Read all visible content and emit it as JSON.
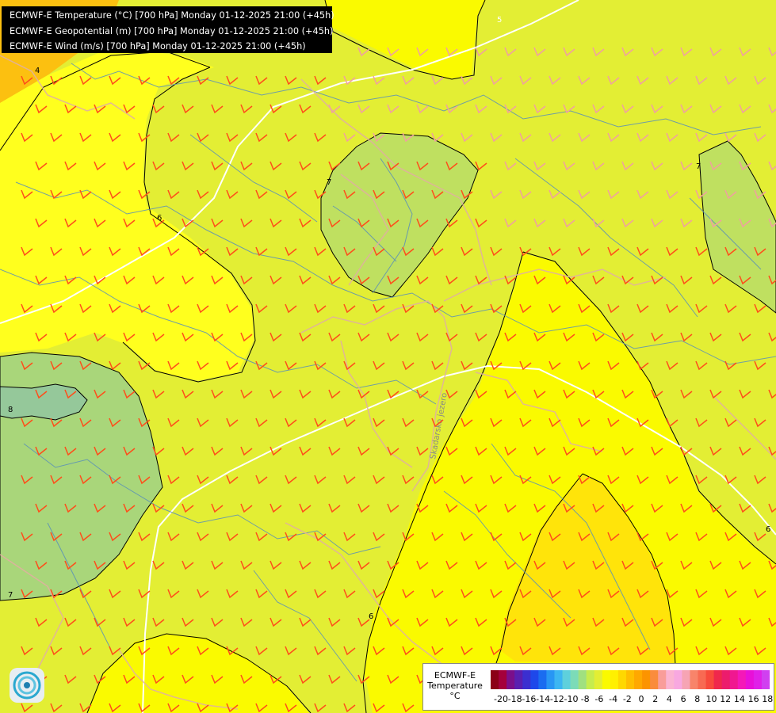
{
  "header": {
    "line1": "ECMWF-E Temperature (°C) [700 hPa] Monday 01-12-2025 21:00 (+45h)",
    "line2": "ECMWF-E Geopotential (m) [700 hPa] Monday 01-12-2025 21:00 (+45h)",
    "line3": "ECMWF-E Wind (m/s) [700 hPa] Monday 01-12-2025 21:00 (+45h)"
  },
  "map": {
    "contour_labels": [
      "4",
      "5",
      "6",
      "7",
      "8",
      "6",
      "7",
      "6",
      "7"
    ],
    "place_label": "Skadarsko jezero",
    "colors": {
      "background_field": "#e3ee34",
      "yellow_field": "#ffff1e",
      "bright_yellow_field": "#fafa00",
      "dark_yellow_field": "#ffe40a",
      "orange_field": "#fcc010",
      "green_field": "#bfe060",
      "teal_field": "#9fcf94",
      "barb_color": "#ff4d1a",
      "border_color": "#e0b0a0",
      "river_color": "#5a90b8",
      "geopotential_line": "#ffffff",
      "isotherm_line": "#000000"
    }
  },
  "legend": {
    "title_line1": "ECMWF-E",
    "title_line2": "Temperature",
    "title_line3": "°C",
    "ticks": [
      "-20",
      "-18",
      "-16",
      "-14",
      "-12",
      "-10",
      "-8",
      "-6",
      "-4",
      "-2",
      "0",
      "2",
      "4",
      "6",
      "8",
      "10",
      "12",
      "14",
      "16",
      "18"
    ],
    "colors": [
      "#8b0016",
      "#a4003b",
      "#7a0f8a",
      "#5a1fb0",
      "#3b2fd0",
      "#1e48ea",
      "#1a6cf0",
      "#2896f4",
      "#3cb6f2",
      "#5ed0dc",
      "#7cdbb8",
      "#a0e080",
      "#c6ec4e",
      "#e3ee34",
      "#fafa00",
      "#fff000",
      "#ffd800",
      "#ffbe00",
      "#ffa800",
      "#fc9400",
      "#fa8c3c",
      "#f99d9a",
      "#fbb4d2",
      "#f8a8e0",
      "#f6a4b4",
      "#f8846a",
      "#f86a52",
      "#f84a3c",
      "#f0284c",
      "#ec1c6c",
      "#f01890",
      "#f418b8",
      "#e810d8",
      "#e020e8",
      "#d040f0"
    ]
  }
}
